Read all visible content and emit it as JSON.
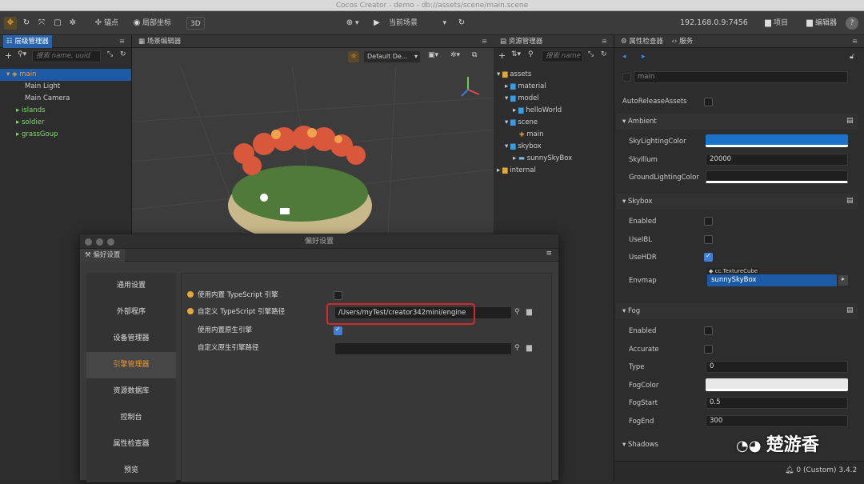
{
  "window": {
    "title": "Cocos Creator - demo - db://assets/scene/main.scene"
  },
  "toolbar": {
    "anchor_label": "锚点",
    "local_coord_label": "局部坐标",
    "mode_3d": "3D",
    "scene_select": "当前场景",
    "ip": "192.168.0.9:7456",
    "project_label": "项目",
    "editor_label": "编辑器",
    "help": "?"
  },
  "hierarchy": {
    "title": "层级管理器",
    "search_placeholder": "搜索 name, uuid",
    "nodes": [
      {
        "label": "main"
      },
      {
        "label": "Main Light"
      },
      {
        "label": "Main Camera"
      },
      {
        "label": "islands"
      },
      {
        "label": "soldier"
      },
      {
        "label": "grassGoup"
      }
    ]
  },
  "scene": {
    "title": "场景编辑器",
    "camera_mode": "Default De..."
  },
  "assets": {
    "title": "资源管理器",
    "search_placeholder": "搜索 name",
    "items": [
      {
        "label": "assets"
      },
      {
        "label": "material"
      },
      {
        "label": "model"
      },
      {
        "label": "helloWorld"
      },
      {
        "label": "scene"
      },
      {
        "label": "main"
      },
      {
        "label": "skybox"
      },
      {
        "label": "sunnySkyBox"
      },
      {
        "label": "internal"
      }
    ]
  },
  "inspector": {
    "tab_inspector": "属性检查器",
    "tab_service": "服务",
    "node_name": "main",
    "auto_release": "AutoReleaseAssets",
    "ambient": {
      "title": "Ambient",
      "sky_color_label": "SkyLightingColor",
      "sky_color": "#1a73c9",
      "sky_illum_label": "SkyIllum",
      "sky_illum": "20000",
      "ground_color_label": "GroundLightingColor"
    },
    "skybox": {
      "title": "Skybox",
      "enabled": "Enabled",
      "use_ibl": "UseIBL",
      "use_hdr": "UseHDR",
      "envmap": "Envmap",
      "envmap_type": "cc.TextureCube",
      "envmap_value": "sunnySkyBox"
    },
    "fog": {
      "title": "Fog",
      "enabled": "Enabled",
      "accurate": "Accurate",
      "type_label": "Type",
      "type_value": "0",
      "fog_color": "FogColor",
      "fog_start_label": "FogStart",
      "fog_start": "0.5",
      "fog_end_label": "FogEnd",
      "fog_end": "300"
    },
    "shadows_title": "Shadows"
  },
  "status": {
    "version": "(Custom) 3.4.2",
    "count": "0"
  },
  "watermark": "楚游香",
  "prefs": {
    "title": "偏好设置",
    "tab": "偏好设置",
    "nav": [
      {
        "label": "通用设置"
      },
      {
        "label": "外部程序"
      },
      {
        "label": "设备管理器"
      },
      {
        "label": "引擎管理器"
      },
      {
        "label": "资源数据库"
      },
      {
        "label": "控制台"
      },
      {
        "label": "属性检查器"
      },
      {
        "label": "预览"
      }
    ],
    "use_builtin_ts": "使用内置 TypeScript 引擎",
    "custom_ts_path": "自定义 TypeScript 引擎路径",
    "custom_ts_path_value": "/Users/myTest/creator342mini/engine",
    "use_builtin_native": "使用内置原生引擎",
    "custom_native_path": "自定义原生引擎路径"
  }
}
